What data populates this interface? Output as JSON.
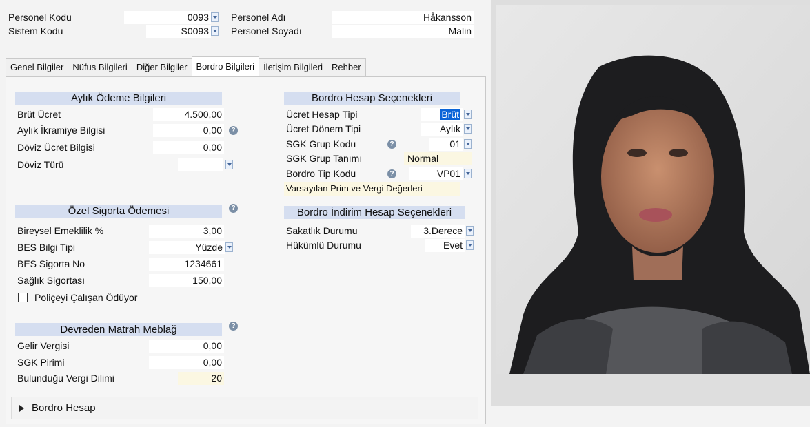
{
  "header": {
    "personel_kodu_label": "Personel Kodu",
    "personel_kodu_value": "0093",
    "sistem_kodu_label": "Sistem Kodu",
    "sistem_kodu_value": "S0093",
    "personel_adi_label": "Personel Adı",
    "personel_adi_value": "Håkansson",
    "personel_soyadi_label": "Personel Soyadı",
    "personel_soyadi_value": "Malin"
  },
  "tabs": [
    {
      "label": "Genel Bilgiler"
    },
    {
      "label": "Nüfus Bilgileri"
    },
    {
      "label": "Diğer Bilgiler"
    },
    {
      "label": "Bordro Bilgileri"
    },
    {
      "label": "İletişim Bilgileri"
    },
    {
      "label": "Rehber"
    }
  ],
  "aylik": {
    "title": "Aylık Ödeme Bilgileri",
    "brut_label": "Brüt Ücret",
    "brut_value": "4.500,00",
    "ikramiye_label": "Aylık İkramiye Bilgisi",
    "ikramiye_value": "0,00",
    "doviz_ucret_label": "Döviz Ücret Bilgisi",
    "doviz_ucret_value": "0,00",
    "doviz_turu_label": "Döviz Türü",
    "doviz_turu_value": ""
  },
  "ozel": {
    "title": "Özel Sigorta Ödemesi",
    "bireysel_label": "Bireysel Emeklilik %",
    "bireysel_value": "3,00",
    "bes_tipi_label": "BES Bilgi Tipi",
    "bes_tipi_value": "Yüzde",
    "bes_no_label": "BES Sigorta No",
    "bes_no_value": "1234661",
    "saglik_label": "Sağlık Sigortası",
    "saglik_value": "150,00",
    "police_label": "Poliçeyi Çalışan Ödüyor",
    "police_checked": false
  },
  "devreden": {
    "title": "Devreden Matrah Meblağ",
    "gelir_label": "Gelir Vergisi",
    "gelir_value": "0,00",
    "sgk_label": "SGK Pirimi",
    "sgk_value": "0,00",
    "dilim_label": "Bulunduğu Vergi Dilimi",
    "dilim_value": "20"
  },
  "bordro": {
    "title": "Bordro Hesap Seçenekleri",
    "hesap_tipi_label": "Ücret Hesap Tipi",
    "hesap_tipi_value": "Brüt",
    "donem_tipi_label": "Ücret Dönem Tipi",
    "donem_tipi_value": "Aylık",
    "sgk_grup_label": "SGK Grup Kodu",
    "sgk_grup_value": "01",
    "sgk_tanim_label": "SGK Grup Tanımı",
    "sgk_tanim_value": "Normal",
    "tip_kodu_label": "Bordro Tip Kodu",
    "tip_kodu_value": "VP01",
    "varsayilan_label": "Varsayılan Prim ve Vergi Değerleri"
  },
  "indirim": {
    "title": "Bordro İndirim Hesap Seçenekleri",
    "sakatlik_label": "Sakatlık Durumu",
    "sakatlik_value": "3.Derece",
    "hukumlu_label": "Hükümlü Durumu",
    "hukumlu_value": "Evet"
  },
  "footer": {
    "bordro_hesap_label": "Bordro Hesap"
  },
  "help_icon_glyph": "?",
  "colors": {
    "section_header_bg": "#d5def0",
    "readonly_field_bg": "#fbf7e2",
    "selection_blue": "#0a64d8"
  }
}
